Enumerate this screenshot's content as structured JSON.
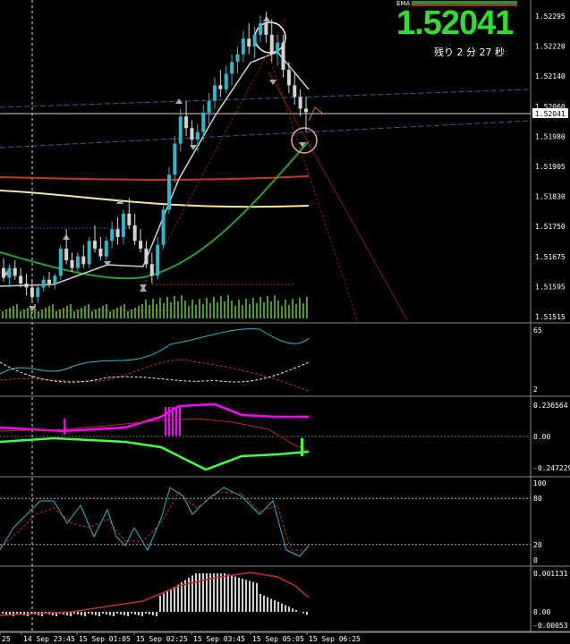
{
  "header": {
    "ema_label": "EMA",
    "price": "1.52041",
    "countdown": "残り 2 分 27 秒"
  },
  "colors": {
    "bull": "#2fb6c9",
    "bear": "#d3d3d3",
    "ema_white": "#cfcfcf",
    "ema_green": "#2e9d2e",
    "ema_red": "#c0392b",
    "ema_yellow": "#f5e6a0",
    "magenta": "#ff00ff",
    "lime": "#44ff44",
    "price_green": "#32dc32"
  },
  "main_axis": {
    "ticks": [
      "1.52295",
      "1.52220",
      "1.52140",
      "1.52060",
      "1.51980",
      "1.51905",
      "1.51830",
      "1.51750",
      "1.51675",
      "1.51595",
      "1.51515"
    ],
    "current": "1.52041"
  },
  "pane_rsi": {
    "ticks": [
      "65",
      "2"
    ]
  },
  "pane_macd": {
    "ticks": [
      "0.236564",
      "0.00",
      "-0.247229"
    ]
  },
  "pane_stoch": {
    "ticks": [
      "100",
      "80",
      "20",
      "0"
    ]
  },
  "pane_osma": {
    "ticks": [
      "0.001131",
      "0.00",
      "-0.00053"
    ]
  },
  "time_axis": [
    "25",
    "14 Sep 23:45",
    "15 Sep 01:05",
    "15 Sep 02:25",
    "15 Sep 03:45",
    "15 Sep 05:05",
    "15 Sep 06:25"
  ],
  "chart_data": [
    {
      "type": "candlestick",
      "title": "",
      "y_range": [
        1.51515,
        1.52295
      ],
      "ohlc": [
        [
          1.5164,
          1.51665,
          1.51605,
          1.51615
        ],
        [
          1.51615,
          1.5165,
          1.5159,
          1.5164
        ],
        [
          1.5164,
          1.5166,
          1.5161,
          1.5162
        ],
        [
          1.5162,
          1.5164,
          1.5159,
          1.516
        ],
        [
          1.516,
          1.51625,
          1.5157,
          1.5159
        ],
        [
          1.5159,
          1.5161,
          1.5155,
          1.51565
        ],
        [
          1.51565,
          1.516,
          1.5155,
          1.5159
        ],
        [
          1.5159,
          1.5162,
          1.5158,
          1.5161
        ],
        [
          1.5161,
          1.5163,
          1.5159,
          1.516
        ],
        [
          1.516,
          1.51625,
          1.51585,
          1.5162
        ],
        [
          1.5162,
          1.517,
          1.5161,
          1.5169
        ],
        [
          1.5169,
          1.5174,
          1.5165,
          1.5166
        ],
        [
          1.5166,
          1.5168,
          1.5163,
          1.5164
        ],
        [
          1.5164,
          1.5168,
          1.5163,
          1.5167
        ],
        [
          1.5167,
          1.517,
          1.5164,
          1.5165
        ],
        [
          1.5165,
          1.5172,
          1.5164,
          1.5171
        ],
        [
          1.5171,
          1.5175,
          1.5168,
          1.5169
        ],
        [
          1.5169,
          1.5172,
          1.5166,
          1.5167
        ],
        [
          1.5167,
          1.5172,
          1.5166,
          1.5171
        ],
        [
          1.5171,
          1.5176,
          1.5169,
          1.5174
        ],
        [
          1.5174,
          1.5177,
          1.517,
          1.5172
        ],
        [
          1.5172,
          1.5179,
          1.517,
          1.5178
        ],
        [
          1.5178,
          1.5182,
          1.5174,
          1.5175
        ],
        [
          1.5175,
          1.5178,
          1.517,
          1.5171
        ],
        [
          1.5171,
          1.5174,
          1.5168,
          1.5169
        ],
        [
          1.5169,
          1.5171,
          1.5164,
          1.5165
        ],
        [
          1.5165,
          1.5168,
          1.516,
          1.5162
        ],
        [
          1.5162,
          1.5172,
          1.5161,
          1.517
        ],
        [
          1.517,
          1.518,
          1.5169,
          1.5179
        ],
        [
          1.5179,
          1.519,
          1.5178,
          1.5188
        ],
        [
          1.5188,
          1.5198,
          1.5186,
          1.5196
        ],
        [
          1.5196,
          1.5205,
          1.5194,
          1.5203
        ],
        [
          1.5203,
          1.5207,
          1.5198,
          1.52
        ],
        [
          1.52,
          1.5202,
          1.5195,
          1.5197
        ],
        [
          1.5197,
          1.5201,
          1.5194,
          1.5199
        ],
        [
          1.5199,
          1.5206,
          1.5197,
          1.5204
        ],
        [
          1.5204,
          1.5209,
          1.5201,
          1.5207
        ],
        [
          1.5207,
          1.5213,
          1.5205,
          1.5211
        ],
        [
          1.5211,
          1.5215,
          1.5208,
          1.521
        ],
        [
          1.521,
          1.5216,
          1.5209,
          1.5214
        ],
        [
          1.5214,
          1.5219,
          1.5211,
          1.5217
        ],
        [
          1.5217,
          1.5221,
          1.5214,
          1.5219
        ],
        [
          1.5219,
          1.5225,
          1.5217,
          1.5223
        ],
        [
          1.5223,
          1.5227,
          1.5219,
          1.5221
        ],
        [
          1.5221,
          1.5226,
          1.5218,
          1.5224
        ],
        [
          1.5224,
          1.5229,
          1.5222,
          1.5227
        ],
        [
          1.5227,
          1.523,
          1.5222,
          1.5224
        ],
        [
          1.5224,
          1.5228,
          1.5217,
          1.5219
        ],
        [
          1.5219,
          1.5224,
          1.5216,
          1.5222
        ],
        [
          1.5222,
          1.5224,
          1.5213,
          1.5215
        ],
        [
          1.5215,
          1.5217,
          1.5209,
          1.5211
        ],
        [
          1.5211,
          1.5214,
          1.5206,
          1.5208
        ],
        [
          1.5208,
          1.521,
          1.5203,
          1.5205
        ],
        [
          1.5205,
          1.5208,
          1.5199,
          1.52041
        ]
      ]
    }
  ]
}
